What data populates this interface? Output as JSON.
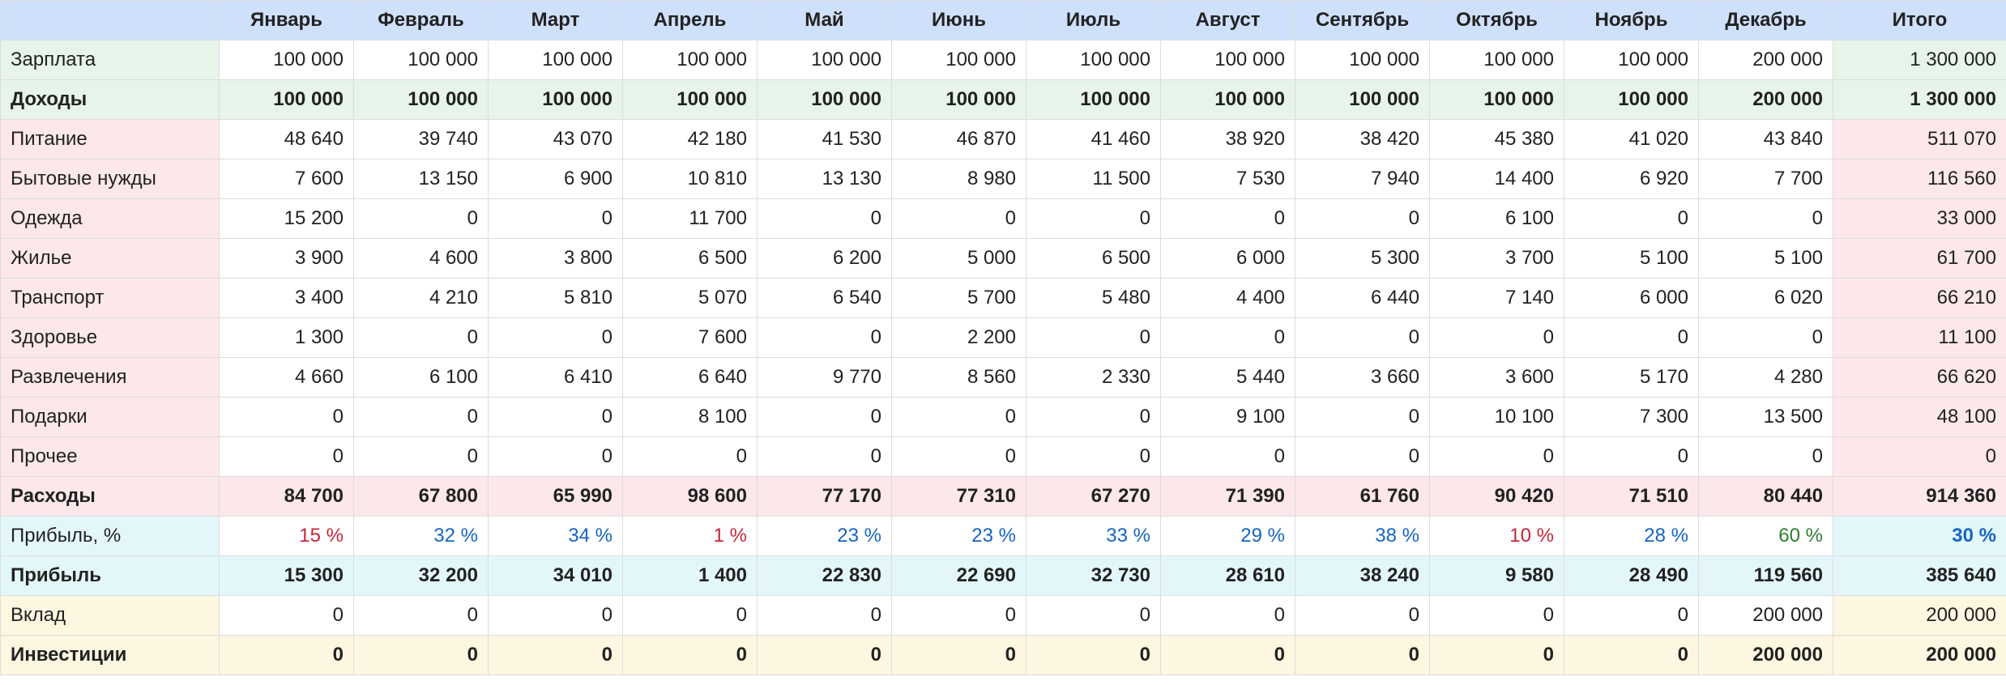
{
  "header": {
    "corner": "",
    "months": [
      "Январь",
      "Февраль",
      "Март",
      "Апрель",
      "Май",
      "Июнь",
      "Июль",
      "Август",
      "Сентябрь",
      "Октябрь",
      "Ноябрь",
      "Декабрь"
    ],
    "total": "Итого"
  },
  "rows": [
    {
      "label": "Зарплата",
      "values": [
        "100 000",
        "100 000",
        "100 000",
        "100 000",
        "100 000",
        "100 000",
        "100 000",
        "100 000",
        "100 000",
        "100 000",
        "100 000",
        "200 000"
      ],
      "total": "1 300 000"
    },
    {
      "label": "Доходы",
      "values": [
        "100 000",
        "100 000",
        "100 000",
        "100 000",
        "100 000",
        "100 000",
        "100 000",
        "100 000",
        "100 000",
        "100 000",
        "100 000",
        "200 000"
      ],
      "total": "1 300 000"
    },
    {
      "label": "Питание",
      "values": [
        "48 640",
        "39 740",
        "43 070",
        "42 180",
        "41 530",
        "46 870",
        "41 460",
        "38 920",
        "38 420",
        "45 380",
        "41 020",
        "43 840"
      ],
      "total": "511 070"
    },
    {
      "label": "Бытовые нужды",
      "values": [
        "7 600",
        "13 150",
        "6 900",
        "10 810",
        "13 130",
        "8 980",
        "11 500",
        "7 530",
        "7 940",
        "14 400",
        "6 920",
        "7 700"
      ],
      "total": "116 560"
    },
    {
      "label": "Одежда",
      "values": [
        "15 200",
        "0",
        "0",
        "11 700",
        "0",
        "0",
        "0",
        "0",
        "0",
        "6 100",
        "0",
        "0"
      ],
      "total": "33 000"
    },
    {
      "label": "Жилье",
      "values": [
        "3 900",
        "4 600",
        "3 800",
        "6 500",
        "6 200",
        "5 000",
        "6 500",
        "6 000",
        "5 300",
        "3 700",
        "5 100",
        "5 100"
      ],
      "total": "61 700"
    },
    {
      "label": "Транспорт",
      "values": [
        "3 400",
        "4 210",
        "5 810",
        "5 070",
        "6 540",
        "5 700",
        "5 480",
        "4 400",
        "6 440",
        "7 140",
        "6 000",
        "6 020"
      ],
      "total": "66 210"
    },
    {
      "label": "Здоровье",
      "values": [
        "1 300",
        "0",
        "0",
        "7 600",
        "0",
        "2 200",
        "0",
        "0",
        "0",
        "0",
        "0",
        "0"
      ],
      "total": "11 100"
    },
    {
      "label": "Развлечения",
      "values": [
        "4 660",
        "6 100",
        "6 410",
        "6 640",
        "9 770",
        "8 560",
        "2 330",
        "5 440",
        "3 660",
        "3 600",
        "5 170",
        "4 280"
      ],
      "total": "66 620"
    },
    {
      "label": "Подарки",
      "values": [
        "0",
        "0",
        "0",
        "8 100",
        "0",
        "0",
        "0",
        "9 100",
        "0",
        "10 100",
        "7 300",
        "13 500"
      ],
      "total": "48 100"
    },
    {
      "label": "Прочее",
      "values": [
        "0",
        "0",
        "0",
        "0",
        "0",
        "0",
        "0",
        "0",
        "0",
        "0",
        "0",
        "0"
      ],
      "total": "0"
    },
    {
      "label": "Расходы",
      "values": [
        "84 700",
        "67 800",
        "65 990",
        "98 600",
        "77 170",
        "77 310",
        "67 270",
        "71 390",
        "61 760",
        "90 420",
        "71 510",
        "80 440"
      ],
      "total": "914 360"
    },
    {
      "label": "Прибыль, %",
      "values": [
        "15 %",
        "32 %",
        "34 %",
        "1 %",
        "23 %",
        "23 %",
        "33 %",
        "29 %",
        "38 %",
        "10 %",
        "28 %",
        "60 %"
      ],
      "total": "30 %"
    },
    {
      "label": "Прибыль",
      "values": [
        "15 300",
        "32 200",
        "34 010",
        "1 400",
        "22 830",
        "22 690",
        "32 730",
        "28 610",
        "38 240",
        "9 580",
        "28 490",
        "119 560"
      ],
      "total": "385 640"
    },
    {
      "label": "Вклад",
      "values": [
        "0",
        "0",
        "0",
        "0",
        "0",
        "0",
        "0",
        "0",
        "0",
        "0",
        "0",
        "200 000"
      ],
      "total": "200 000"
    },
    {
      "label": "Инвестиции",
      "values": [
        "0",
        "0",
        "0",
        "0",
        "0",
        "0",
        "0",
        "0",
        "0",
        "0",
        "0",
        "200 000"
      ],
      "total": "200 000"
    }
  ],
  "colors": {
    "header_bg": "#cfe0fb",
    "income_bg": "#e6f4ea",
    "expense_bg": "#fce8ea",
    "profit_bg": "#e3f7fb",
    "savings_bg": "#fdf6e0",
    "percent_low": "#c5263a",
    "percent_mid": "#1565c0",
    "percent_high": "#2e7d32"
  }
}
